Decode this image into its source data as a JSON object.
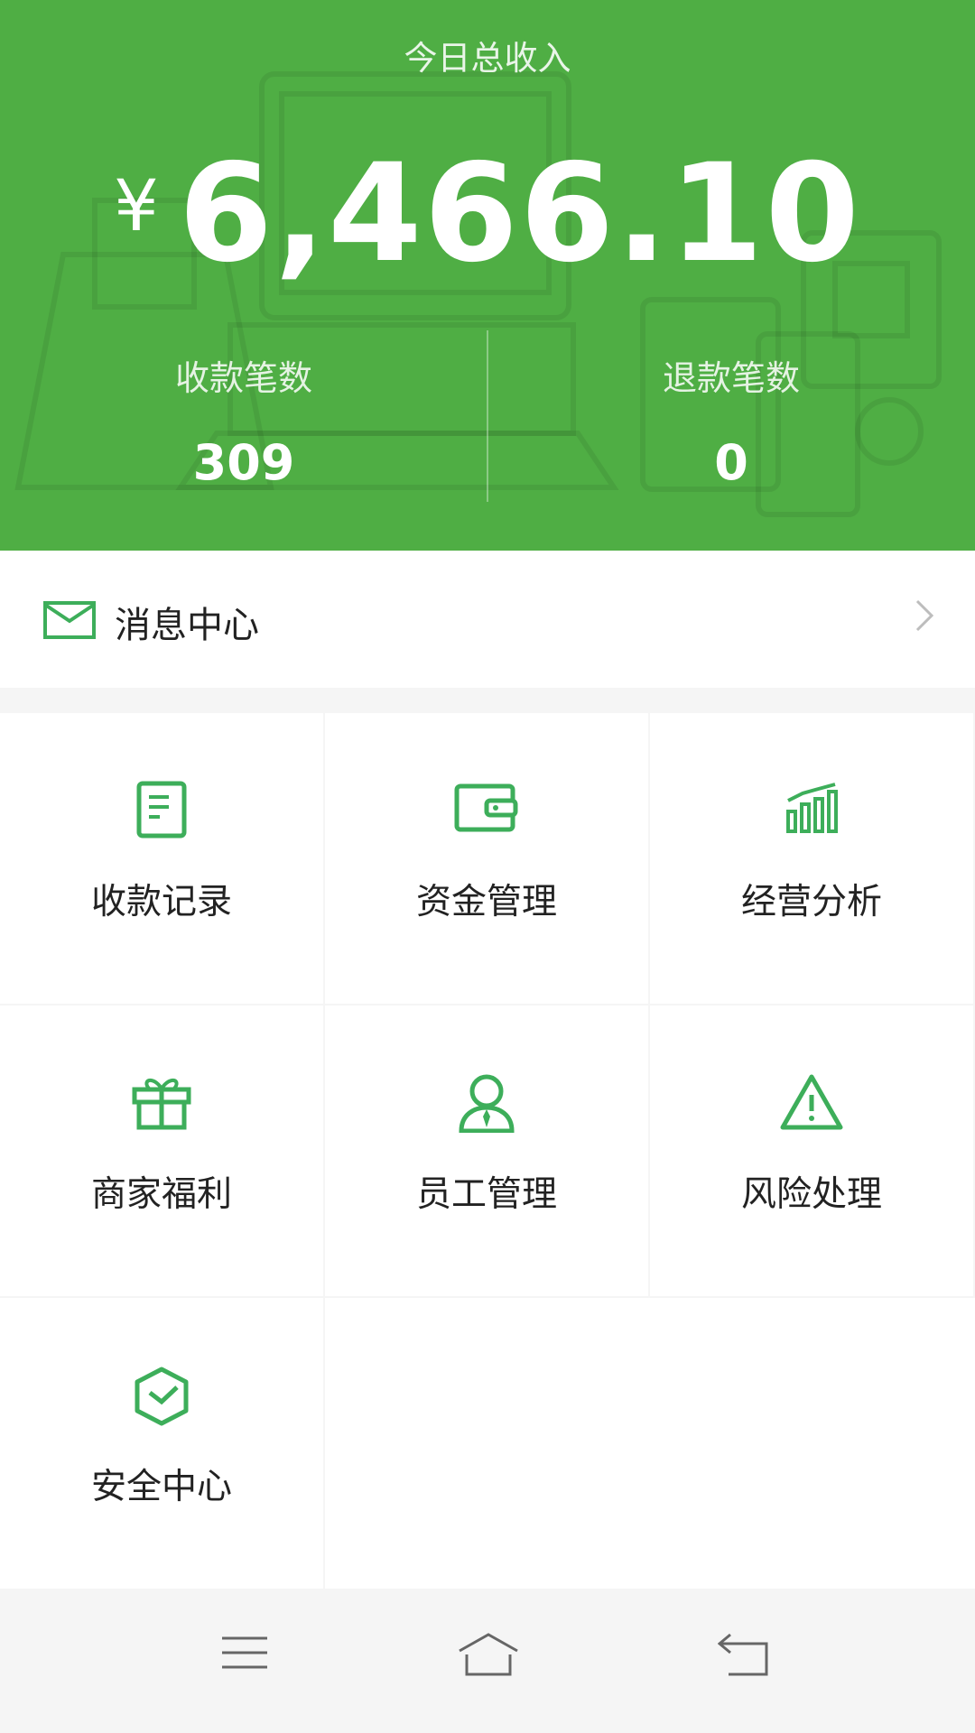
{
  "header": {
    "title": "今日总收入",
    "currency_symbol": "¥",
    "total_amount": "6,466.10",
    "stats": [
      {
        "label": "收款笔数",
        "value": "309"
      },
      {
        "label": "退款笔数",
        "value": "0"
      }
    ]
  },
  "message_center": {
    "label": "消息中心",
    "icon": "envelope-icon"
  },
  "grid": [
    {
      "label": "收款记录",
      "icon": "document-icon"
    },
    {
      "label": "资金管理",
      "icon": "wallet-icon"
    },
    {
      "label": "经营分析",
      "icon": "bar-chart-icon"
    },
    {
      "label": "商家福利",
      "icon": "gift-icon"
    },
    {
      "label": "员工管理",
      "icon": "employee-icon"
    },
    {
      "label": "风险处理",
      "icon": "warning-icon"
    },
    {
      "label": "安全中心",
      "icon": "shield-icon"
    }
  ],
  "navbar": {
    "buttons": [
      "menu-icon",
      "home-icon",
      "back-icon"
    ]
  },
  "colors": {
    "brand_green": "#4fae44",
    "icon_green": "#3dae5a"
  }
}
